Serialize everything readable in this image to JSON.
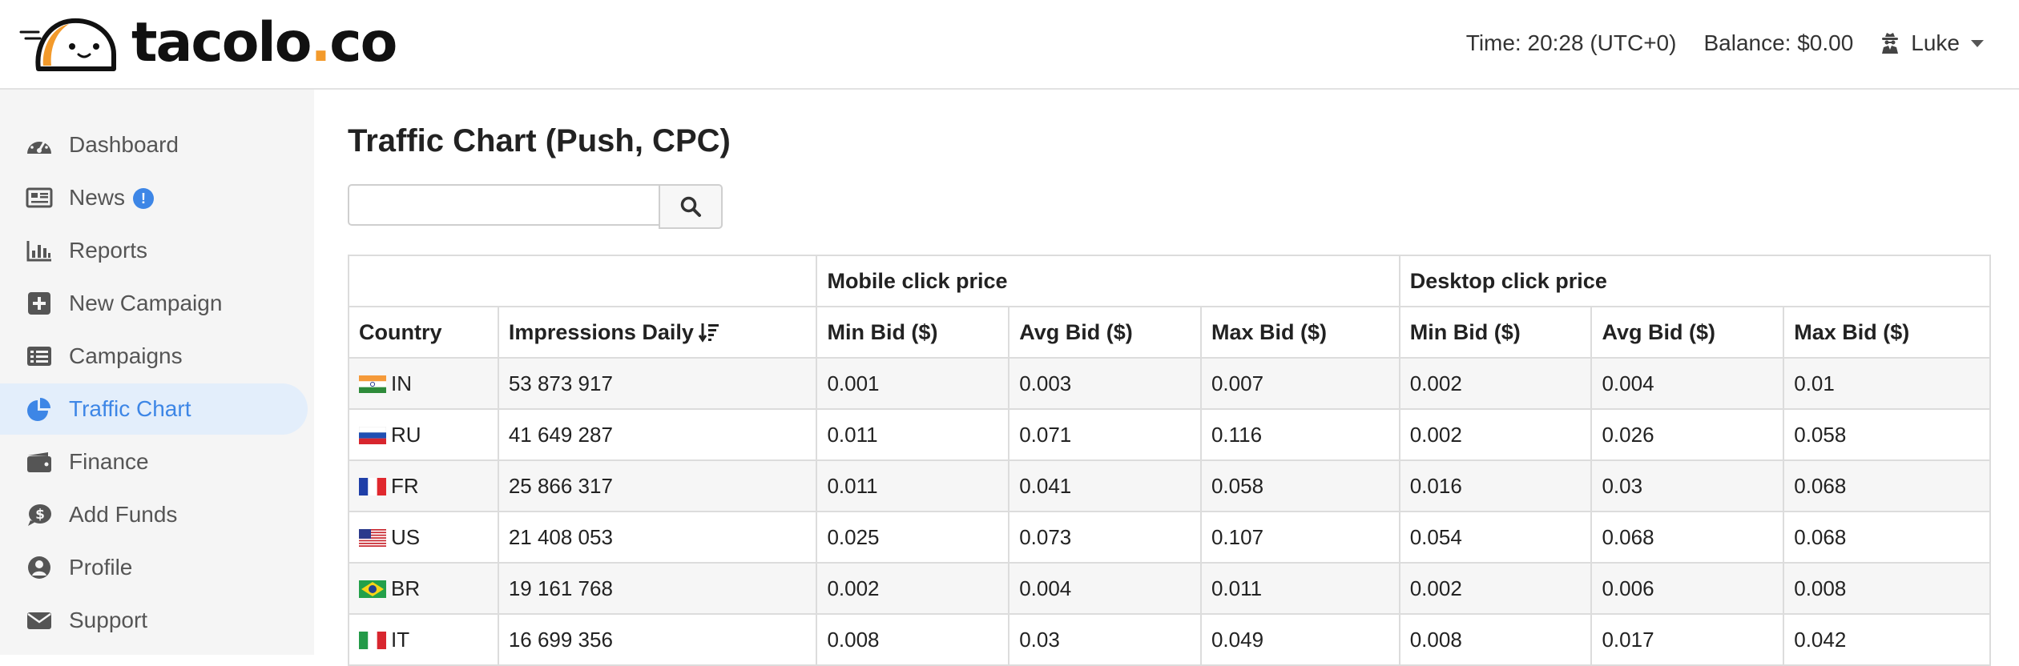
{
  "brand": {
    "name_main": "tacolo",
    "name_dot": ".",
    "name_tld": "co"
  },
  "header": {
    "time": "Time: 20:28 (UTC+0)",
    "balance": "Balance: $0.00",
    "user": "Luke",
    "user_icon": "user-secret-icon"
  },
  "colors": {
    "accent": "#3d86e6",
    "brand_orange": "#f39a2b",
    "sidebar_bg": "#f5f5f5"
  },
  "sidebar": {
    "items": [
      {
        "label": "Dashboard",
        "icon": "tachometer-icon"
      },
      {
        "label": "News",
        "icon": "newspaper-icon",
        "badge": "!"
      },
      {
        "label": "Reports",
        "icon": "bar-chart-icon"
      },
      {
        "label": "New Campaign",
        "icon": "plus-square-icon"
      },
      {
        "label": "Campaigns",
        "icon": "list-icon"
      },
      {
        "label": "Traffic Chart",
        "icon": "pie-chart-icon",
        "active": true
      },
      {
        "label": "Finance",
        "icon": "wallet-icon"
      },
      {
        "label": "Add Funds",
        "icon": "dollar-comment-icon"
      },
      {
        "label": "Profile",
        "icon": "user-circle-icon"
      },
      {
        "label": "Support",
        "icon": "envelope-icon"
      }
    ]
  },
  "main": {
    "title": "Traffic Chart (Push, CPC)",
    "search": {
      "value": "",
      "placeholder": "",
      "icon": "search-icon"
    }
  },
  "table": {
    "group_headers": {
      "mobile": "Mobile click price",
      "desktop": "Desktop click price"
    },
    "columns": [
      "Country",
      "Impressions Daily",
      "Min Bid ($)",
      "Avg Bid ($)",
      "Max Bid ($)",
      "Min Bid ($)",
      "Avg Bid ($)",
      "Max Bid ($)"
    ],
    "rows": [
      {
        "flag": "india-flag",
        "country": "IN",
        "impressions": "53 873 917",
        "m_min": "0.001",
        "m_avg": "0.003",
        "m_max": "0.007",
        "d_min": "0.002",
        "d_avg": "0.004",
        "d_max": "0.01"
      },
      {
        "flag": "russia-flag",
        "country": "RU",
        "impressions": "41 649 287",
        "m_min": "0.011",
        "m_avg": "0.071",
        "m_max": "0.116",
        "d_min": "0.002",
        "d_avg": "0.026",
        "d_max": "0.058"
      },
      {
        "flag": "france-flag",
        "country": "FR",
        "impressions": "25 866 317",
        "m_min": "0.011",
        "m_avg": "0.041",
        "m_max": "0.058",
        "d_min": "0.016",
        "d_avg": "0.03",
        "d_max": "0.068"
      },
      {
        "flag": "usa-flag",
        "country": "US",
        "impressions": "21 408 053",
        "m_min": "0.025",
        "m_avg": "0.073",
        "m_max": "0.107",
        "d_min": "0.054",
        "d_avg": "0.068",
        "d_max": "0.068"
      },
      {
        "flag": "brazil-flag",
        "country": "BR",
        "impressions": "19 161 768",
        "m_min": "0.002",
        "m_avg": "0.004",
        "m_max": "0.011",
        "d_min": "0.002",
        "d_avg": "0.006",
        "d_max": "0.008"
      },
      {
        "flag": "italy-flag",
        "country": "IT",
        "impressions": "16 699 356",
        "m_min": "0.008",
        "m_avg": "0.03",
        "m_max": "0.049",
        "d_min": "0.008",
        "d_avg": "0.017",
        "d_max": "0.042"
      }
    ]
  }
}
